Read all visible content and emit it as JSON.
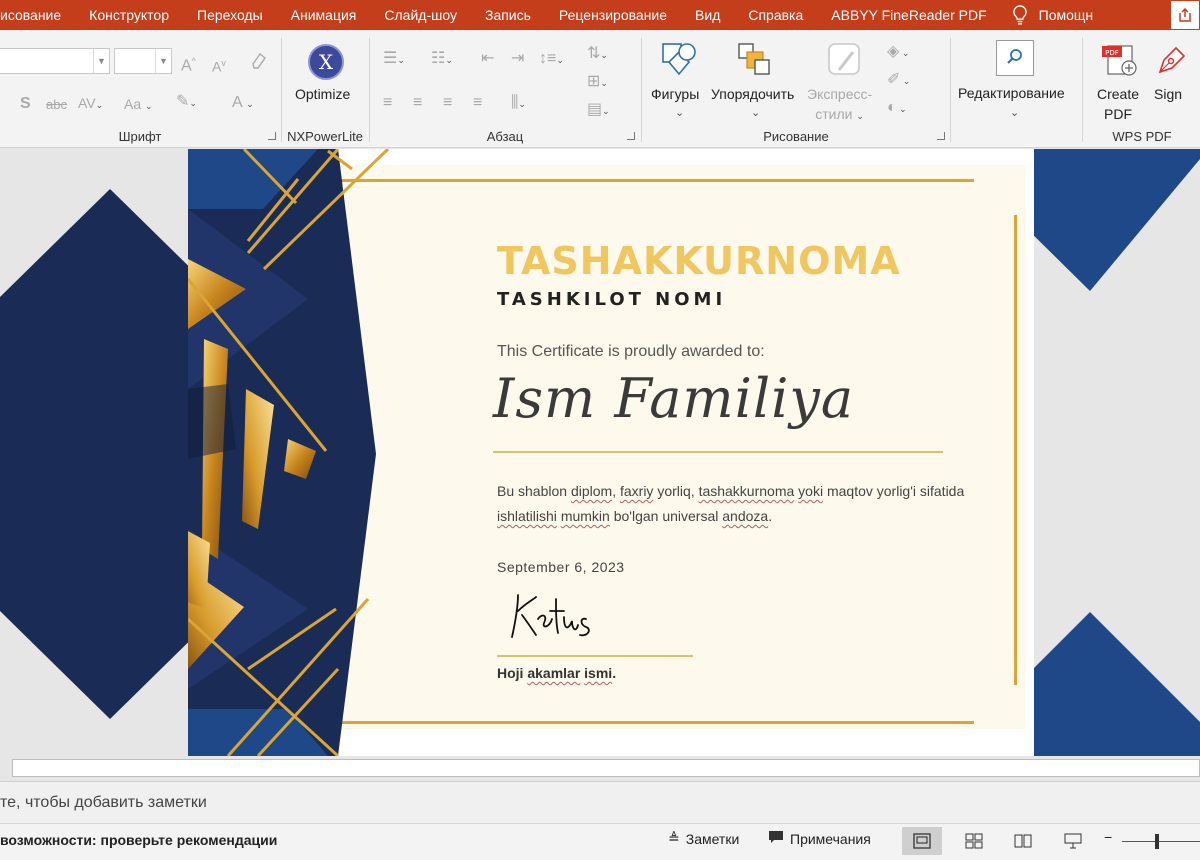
{
  "menu": {
    "tabs": [
      "исование",
      "Конструктор",
      "Переходы",
      "Анимация",
      "Слайд-шоу",
      "Запись",
      "Рецензирование",
      "Вид",
      "Справка",
      "ABBYY FineReader PDF"
    ],
    "help": "Помощн"
  },
  "ribbon": {
    "font_group_label": "Шрифт",
    "nxpowerlite_label": "NXPowerLite",
    "optimize_label": "Optimize",
    "paragraph_group_label": "Абзац",
    "drawing_group_label": "Рисование",
    "shapes_label": "Фигуры",
    "arrange_label": "Упорядочить",
    "quick_styles_label_1": "Экспресс-",
    "quick_styles_label_2": "стили",
    "editing_label": "Редактирование",
    "create_pdf_label_1": "Create",
    "create_pdf_label_2": "PDF",
    "sign_label": "Sign",
    "wps_group_label": "WPS PDF",
    "strike_icon_text": "abc"
  },
  "certificate": {
    "title": "TASHAKKURNOMA",
    "organization": "TASHKILOT NOMI",
    "awarded_text": "This Certificate is proudly awarded to:",
    "recipient": "Ism Familiya",
    "desc_1": "Bu shablon ",
    "desc_w1": "diplom",
    "desc_2": ", ",
    "desc_w2": "faxriy",
    "desc_3": " yorliq, ",
    "desc_w3": "tashakkurnoma",
    "desc_4": " ",
    "desc_w4": "yoki",
    "desc_5": " maqtov yorlig'i sifatida ",
    "desc_w5": "ishlatilishi",
    "desc_6": " ",
    "desc_w6": "mumkin",
    "desc_7": " bo'lgan universal ",
    "desc_w7": "andoza",
    "desc_8": ".",
    "date": "September 6, 2023",
    "signer_1": "Hoji ",
    "signer_w1": "akamlar",
    "signer_2": " ",
    "signer_w2": "ismi",
    "signer_3": "."
  },
  "notes": {
    "placeholder": "те, чтобы добавить заметки"
  },
  "status": {
    "accessibility": "возможности: проверьте рекомендации",
    "notes_btn": "Заметки",
    "comments_btn": "Примечания"
  },
  "colors": {
    "menubar": "#c43e1c",
    "navy": "#1a2b55",
    "royal_blue": "#1f4888",
    "gold": "#d9a535",
    "title_gold": "#f0c660",
    "cream": "#fdf9ec"
  }
}
